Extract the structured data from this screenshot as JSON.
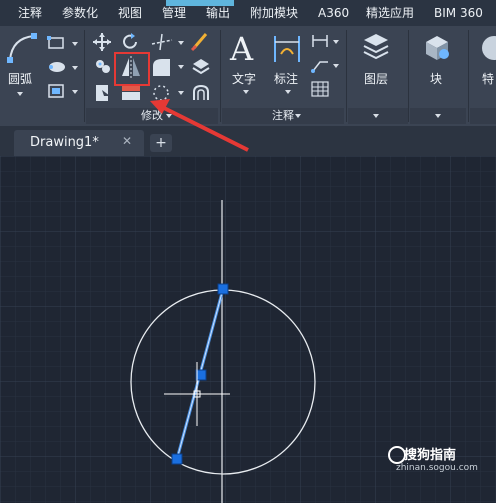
{
  "menu": {
    "items": [
      "注释",
      "参数化",
      "视图",
      "管理",
      "输出",
      "附加模块",
      "A360",
      "精选应用",
      "BIM 360"
    ]
  },
  "ribbon": {
    "arc_label": "圆弧",
    "modify_panel_title": "修改",
    "text_label": "文字",
    "dimension_label": "标注",
    "annotation_panel_title": "注释",
    "layers_label": "图层",
    "block_label": "块",
    "properties_label_partial": "特"
  },
  "tabs": {
    "active": "Drawing1*",
    "close_symbol": "✕",
    "new_tab_symbol": "+"
  },
  "watermark": {
    "brand": "搜狗指南",
    "url": "zhinan.sogou.com"
  },
  "colors": {
    "canvas_bg": "#1f2633",
    "grid": "#2b3442",
    "grid_major": "#323c4b",
    "selected_line": "#4a90e2",
    "grip": "#1a6fe0",
    "highlight_box": "#e53935",
    "arrow": "#e53935"
  },
  "icons": [
    "arc-icon",
    "move-icon",
    "rotate-icon",
    "trim-icon",
    "erase-icon",
    "copy-icon",
    "mirror-icon",
    "fillet-icon",
    "explode-icon",
    "stretch-icon",
    "scale-icon",
    "array-icon",
    "offset-icon",
    "text-icon",
    "dimension-icon",
    "layers-icon",
    "block-icon"
  ]
}
